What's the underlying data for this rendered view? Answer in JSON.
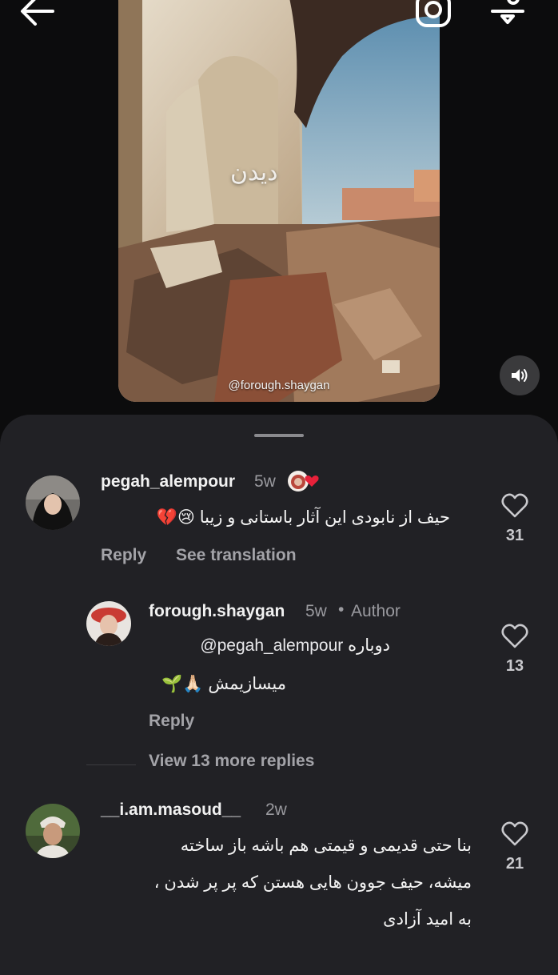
{
  "video": {
    "watermark": "@forough.shaygan",
    "overlay_word": "دیدن"
  },
  "comments": [
    {
      "username": "pegah_alempour",
      "time": "5w",
      "text": "حیف از نابودی این آثار باستانی و زیبا 😢💔",
      "reply_label": "Reply",
      "translate_label": "See translation",
      "likes": "31"
    },
    {
      "username": "forough.shaygan",
      "time": "5w",
      "author_label": "Author",
      "mention": "@pegah_alempour",
      "text_line1": "دوباره",
      "text_line2": "میسازیمش 🙏🏻🌱",
      "reply_label": "Reply",
      "likes": "13"
    },
    {
      "username": "__i.am.masoud__",
      "time": "2w",
      "text_line1": "بنا حتی قدیمی و قیمتی هم باشه باز ساخته",
      "text_line2": "میشه، حیف جوون هایی هستن که پر پر شدن ،",
      "text_line3": "به امید آزادی",
      "likes": "21"
    }
  ],
  "view_more_replies": "View 13 more replies",
  "colors": {
    "sheet_bg": "#212125",
    "heart_red": "#e8213a"
  }
}
